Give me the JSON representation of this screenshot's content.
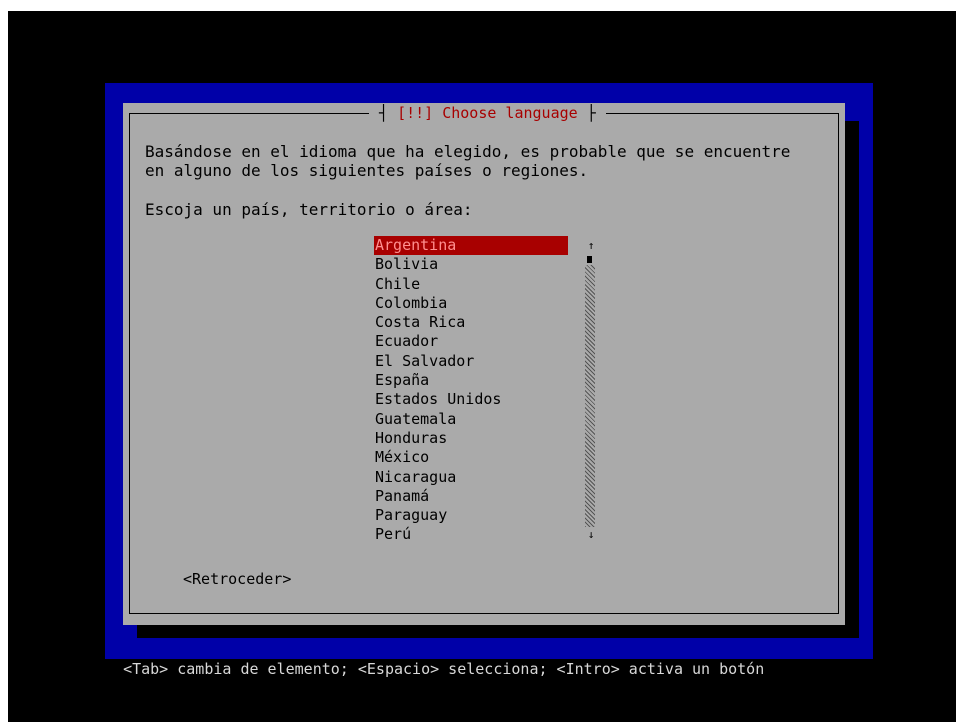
{
  "dialog": {
    "title": "[!!] Choose language",
    "message_line1": "Basándose en el idioma que ha elegido, es probable que se encuentre",
    "message_line2": "en alguno de los siguientes países o regiones.",
    "prompt": "Escoja un país, territorio o área:",
    "countries": [
      "Argentina",
      "Bolivia",
      "Chile",
      "Colombia",
      "Costa Rica",
      "Ecuador",
      "El Salvador",
      "España",
      "Estados Unidos",
      "Guatemala",
      "Honduras",
      "México",
      "Nicaragua",
      "Panamá",
      "Paraguay",
      "Perú"
    ],
    "selected_country": "Argentina",
    "back_button": "<Retroceder>"
  },
  "status_bar": {
    "help_text": "<Tab> cambia de elemento; <Espacio> selecciona; <Intro> activa un botón"
  },
  "scrollbar": {
    "up_arrow": "↑",
    "down_arrow": "↓"
  },
  "colors": {
    "screen_background": "#000000",
    "installer_blue": "#0000a8",
    "dialog_gray": "#aaaaaa",
    "title_red": "#a80000",
    "selection_red": "#a80000"
  }
}
